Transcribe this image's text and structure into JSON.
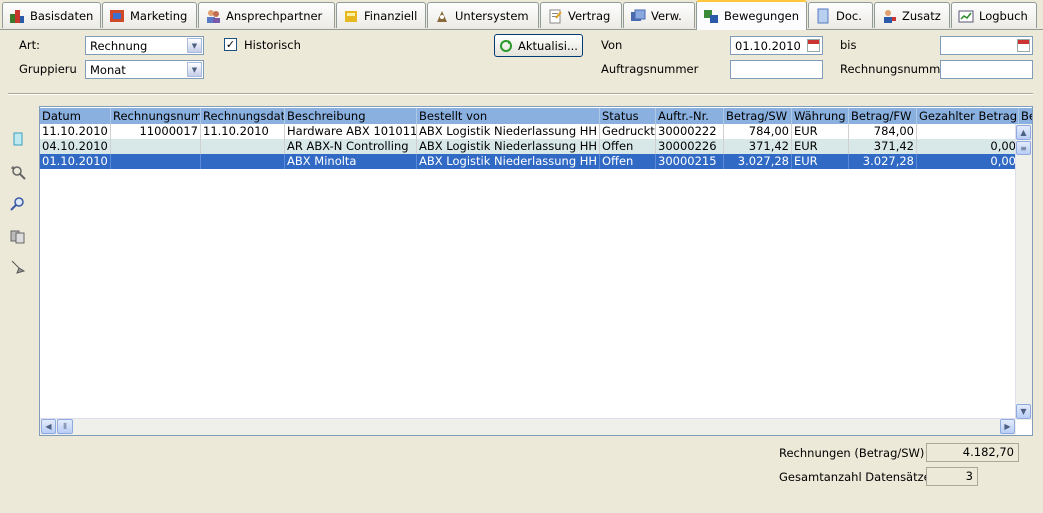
{
  "tabs": [
    {
      "label": "Basisdaten",
      "icon": "basisdaten-icon"
    },
    {
      "label": "Marketing",
      "icon": "marketing-icon"
    },
    {
      "label": "Ansprechpartner",
      "icon": "ansprechpartner-icon"
    },
    {
      "label": "Finanziell",
      "icon": "finanziell-icon"
    },
    {
      "label": "Untersystem",
      "icon": "untersystem-icon"
    },
    {
      "label": "Vertrag",
      "icon": "vertrag-icon"
    },
    {
      "label": "Verw.",
      "icon": "verw-icon"
    },
    {
      "label": "Bewegungen",
      "icon": "bewegungen-icon"
    },
    {
      "label": "Doc.",
      "icon": "doc-icon"
    },
    {
      "label": "Zusatz",
      "icon": "zusatz-icon"
    },
    {
      "label": "Logbuch",
      "icon": "logbuch-icon"
    }
  ],
  "form": {
    "art_label": "Art:",
    "art_value": "Rechnung",
    "group_label": "Gruppieru",
    "group_value": "Monat",
    "historisch_label": "Historisch",
    "historisch_checked": "✓",
    "refresh_label": "Aktualisi...",
    "von_label": "Von",
    "von_value": "01.10.2010",
    "bis_label": "bis",
    "bis_value": "",
    "auftrag_label": "Auftragsnummer",
    "auftrag_value": "",
    "rechnung_label": "Rechnungsnumme",
    "rechnung_value": ""
  },
  "table": {
    "columns": [
      "Datum",
      "Rechnungsnum",
      "Rechnungsdat",
      "Beschreibung",
      "Bestellt von",
      "Status",
      "Auftr.-Nr.",
      "Betrag/SW",
      "Währung",
      "Betrag/FW",
      "Gezahlter Betrag",
      "Be"
    ],
    "rows": [
      [
        "11.10.2010",
        "11000017",
        "11.10.2010",
        "Hardware ABX 101011",
        "ABX Logistik Niederlassung HH",
        "Gedruckt",
        "30000222",
        "784,00",
        "EUR",
        "784,00",
        "",
        ""
      ],
      [
        "04.10.2010",
        "",
        "",
        "AR ABX-N Controlling",
        "ABX Logistik Niederlassung HH",
        "Offen",
        "30000226",
        "371,42",
        "EUR",
        "371,42",
        "0,00",
        ""
      ],
      [
        "01.10.2010",
        "",
        "",
        "ABX Minolta",
        "ABX Logistik Niederlassung HH",
        "Offen",
        "30000215",
        "3.027,28",
        "EUR",
        "3.027,28",
        "0,00",
        ""
      ]
    ]
  },
  "summary": {
    "total_label": "Rechnungen (Betrag/SW)",
    "total_value": "4.182,70",
    "count_label": "Gesamtanzahl Datensätze",
    "count_value": "3"
  },
  "colors": {
    "accent": "#ffc83c",
    "header": "#8ab0e0",
    "selected": "#316ac5"
  }
}
